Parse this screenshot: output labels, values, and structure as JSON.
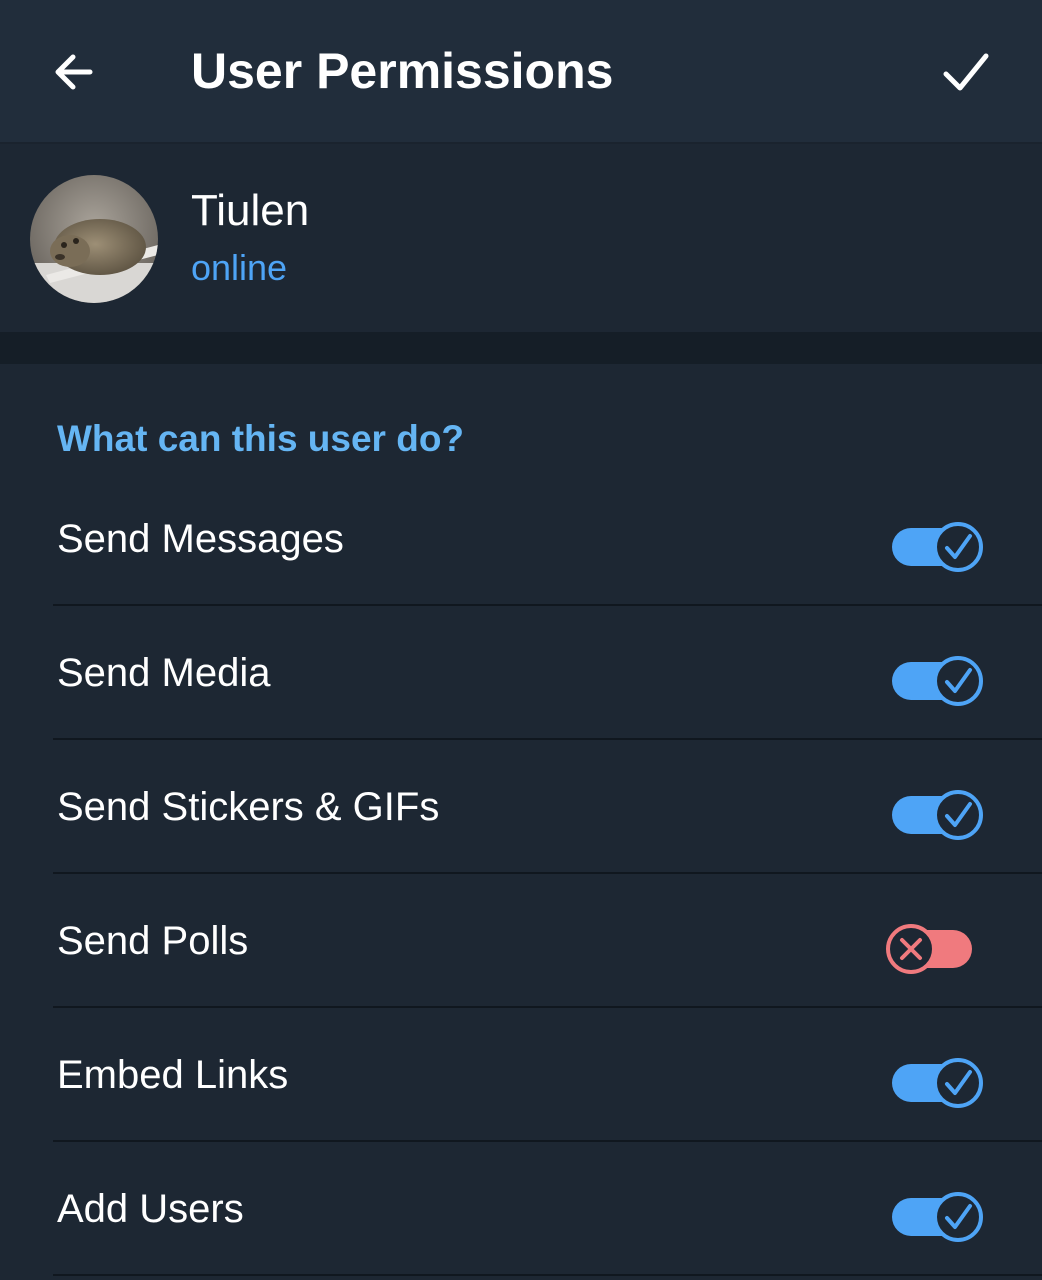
{
  "header": {
    "title": "User Permissions",
    "back_icon": "arrow-left-icon",
    "done_icon": "checkmark-icon"
  },
  "user": {
    "name": "Tiulen",
    "status": "online"
  },
  "permissions": {
    "section_title": "What can this user do?",
    "items": [
      {
        "label": "Send Messages",
        "enabled": true
      },
      {
        "label": "Send Media",
        "enabled": true
      },
      {
        "label": "Send Stickers & GIFs",
        "enabled": true
      },
      {
        "label": "Send Polls",
        "enabled": false
      },
      {
        "label": "Embed Links",
        "enabled": true
      },
      {
        "label": "Add Users",
        "enabled": true
      }
    ]
  },
  "colors": {
    "header_bg": "#212d3b",
    "page_bg": "#1d2733",
    "accent": "#4ea4f6",
    "section_title": "#65b5f3",
    "toggle_on": "#4ea4f6",
    "toggle_off": "#f07a7e"
  }
}
